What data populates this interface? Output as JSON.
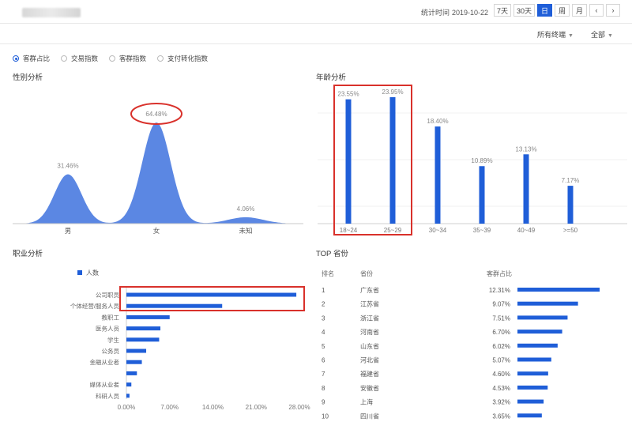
{
  "header": {
    "stat_time_label": "统计时间",
    "stat_time_value": "2019-10-22",
    "periods": [
      "7天",
      "30天",
      "日",
      "周",
      "月"
    ],
    "active_period": "日",
    "prev_icon": "chevron-left-icon",
    "next_icon": "chevron-right-icon",
    "channel_select": "所有终端",
    "scope_select": "全部"
  },
  "radio_options": [
    "客群占比",
    "交易指数",
    "客群指数",
    "支付转化指数"
  ],
  "selected_radio": "客群占比",
  "accent_color": "#1f5ed8",
  "highlight_color": "#d9312b",
  "sections": {
    "gender": "性别分析",
    "age": "年龄分析",
    "occupation": "职业分析",
    "province": "TOP 省份"
  },
  "chart_data": [
    {
      "type": "area",
      "title": "性别分析",
      "categories": [
        "男",
        "女",
        "未知"
      ],
      "values": [
        31.46,
        64.48,
        4.06
      ],
      "data_labels": [
        "31.46%",
        "64.48%",
        "4.06%"
      ],
      "highlighted": "女"
    },
    {
      "type": "bar",
      "title": "年龄分析",
      "categories": [
        "18~24",
        "25~29",
        "30~34",
        "35~39",
        "40~49",
        ">=50"
      ],
      "values": [
        23.55,
        23.95,
        18.4,
        10.89,
        13.13,
        7.17
      ],
      "data_labels": [
        "23.55%",
        "23.95%",
        "18.40%",
        "10.89%",
        "13.13%",
        "7.17%"
      ],
      "highlighted": [
        "18~24",
        "25~29"
      ]
    },
    {
      "type": "bar",
      "orientation": "horizontal",
      "title": "职业分析",
      "legend": "人数",
      "categories": [
        "公司职员",
        "个体经营/服务人员",
        "教职工",
        "医务人员",
        "学生",
        "公务员",
        "金融从业者",
        "",
        "媒体从业者",
        "科研人员"
      ],
      "values": [
        27.5,
        15.5,
        7.0,
        5.5,
        5.3,
        3.2,
        2.5,
        1.7,
        0.8,
        0.5
      ],
      "xlim": [
        0,
        28
      ],
      "xticks": [
        "0.00%",
        "7.00%",
        "14.00%",
        "21.00%",
        "28.00%"
      ],
      "highlighted": [
        "公司职员",
        "个体经营/服务人员"
      ]
    },
    {
      "type": "table",
      "title": "TOP 省份",
      "columns": [
        "排名",
        "省份",
        "客群占比"
      ],
      "rows": [
        {
          "rank": "1",
          "province": "广东省",
          "share": "12.31%",
          "value": 12.31
        },
        {
          "rank": "2",
          "province": "江苏省",
          "share": "9.07%",
          "value": 9.07
        },
        {
          "rank": "3",
          "province": "浙江省",
          "share": "7.51%",
          "value": 7.51
        },
        {
          "rank": "4",
          "province": "河南省",
          "share": "6.70%",
          "value": 6.7
        },
        {
          "rank": "5",
          "province": "山东省",
          "share": "6.02%",
          "value": 6.02
        },
        {
          "rank": "6",
          "province": "河北省",
          "share": "5.07%",
          "value": 5.07
        },
        {
          "rank": "7",
          "province": "福建省",
          "share": "4.60%",
          "value": 4.6
        },
        {
          "rank": "8",
          "province": "安徽省",
          "share": "4.53%",
          "value": 4.53
        },
        {
          "rank": "9",
          "province": "上海",
          "share": "3.92%",
          "value": 3.92
        },
        {
          "rank": "10",
          "province": "四川省",
          "share": "3.65%",
          "value": 3.65
        }
      ]
    }
  ]
}
